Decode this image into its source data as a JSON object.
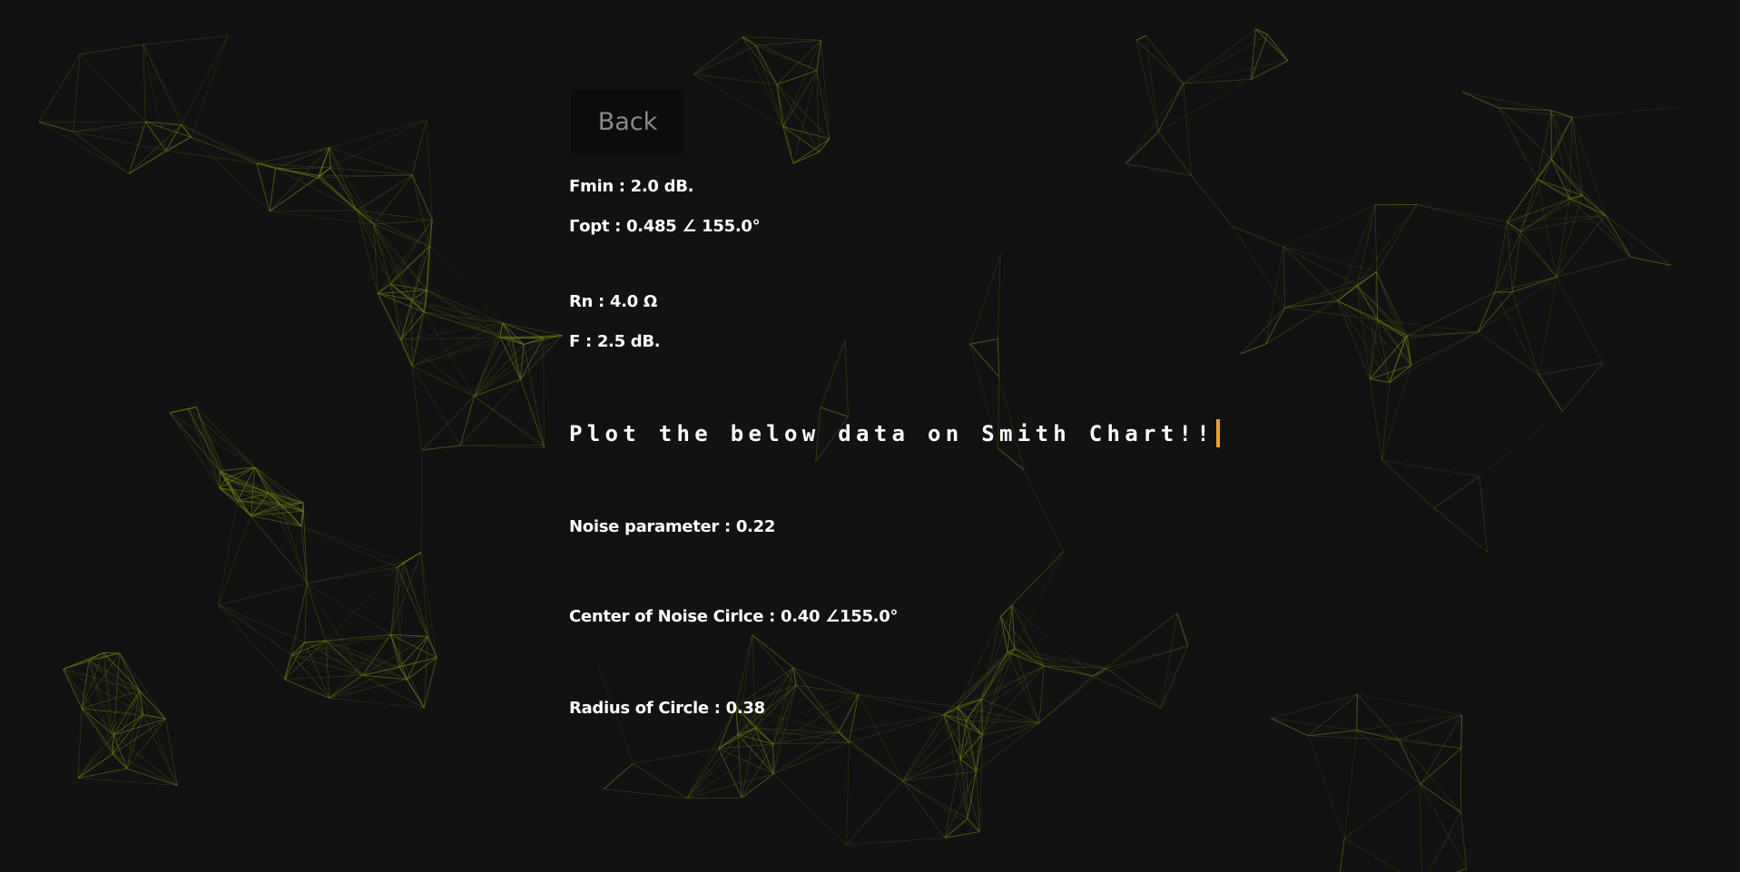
{
  "nav": {
    "back_label": "Back"
  },
  "params": {
    "fmin": "Fmin : 2.0 dB.",
    "gamma_opt": "Γopt : 0.485 ∠ 155.0°",
    "rn": "Rn : 4.0 Ω",
    "f": "F : 2.5 dB."
  },
  "prompt": {
    "text": "Plot the below data on Smith Chart!!"
  },
  "results": {
    "noise_parameter": "Noise parameter : 0.22",
    "center": "Center of Noise Cirlce : 0.40 ∠155.0°",
    "radius": "Radius of Circle : 0.38"
  },
  "theme": {
    "background": "#121212",
    "network_line": "#6b7a12",
    "caret": "#f0a020",
    "back_bg": "#0c0c0c",
    "back_text": "#8a8a8a"
  }
}
